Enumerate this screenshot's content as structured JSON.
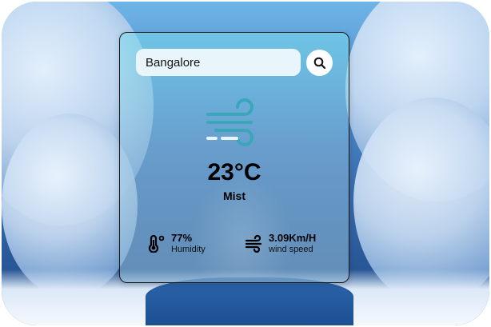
{
  "search": {
    "value": "Bangalore",
    "icon": "search-icon"
  },
  "weather": {
    "icon": "wind-mist-icon",
    "temperature": "23°C",
    "description": "Mist"
  },
  "stats": {
    "humidity": {
      "value": "77%",
      "label": "Humidity",
      "icon": "thermometer-icon"
    },
    "wind": {
      "value": "3.09Km/H",
      "label": "wind speed",
      "icon": "wind-icon"
    }
  },
  "colors": {
    "card_border": "#1a1a1a",
    "icon_teal": "#3aa6b9"
  }
}
